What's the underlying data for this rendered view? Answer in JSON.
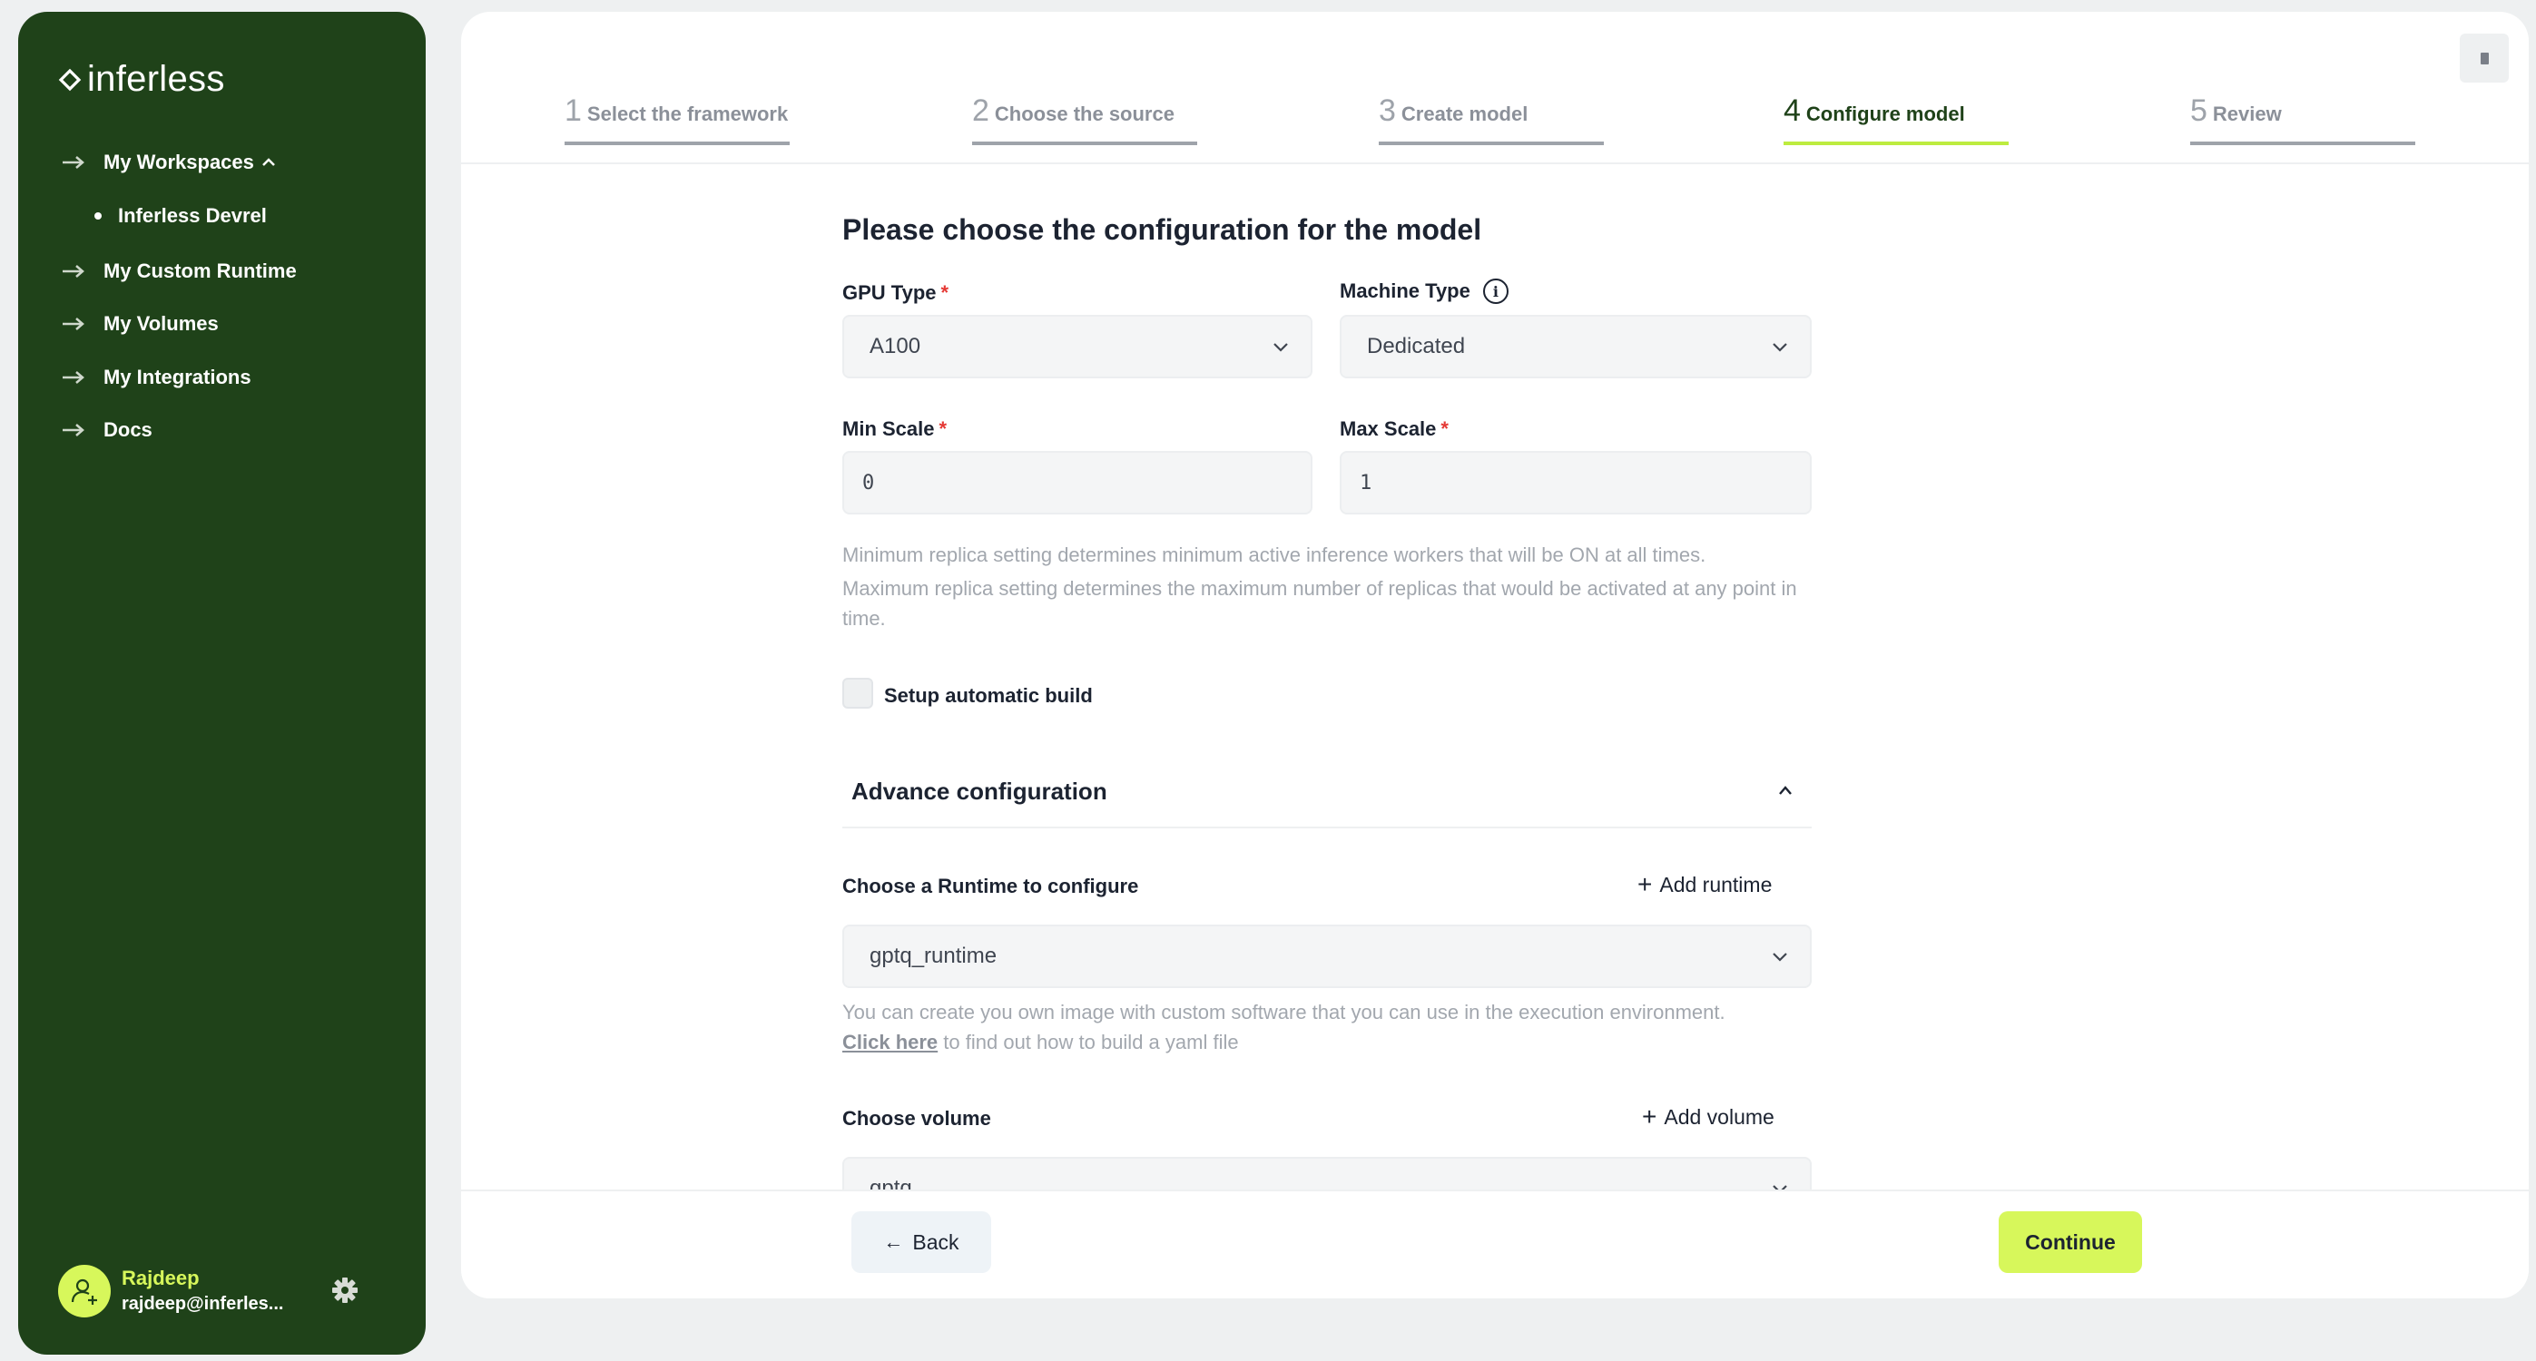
{
  "sidebar": {
    "logo": "inferless",
    "workspaces_label": "My Workspaces",
    "workspace_item": "Inferless Devrel",
    "items": [
      {
        "label": "My Custom Runtime"
      },
      {
        "label": "My Volumes"
      },
      {
        "label": "My Integrations"
      },
      {
        "label": "Docs"
      }
    ],
    "user": {
      "name": "Rajdeep",
      "email": "rajdeep@inferles..."
    }
  },
  "steps": [
    {
      "num": "1",
      "label": "Select the framework"
    },
    {
      "num": "2",
      "label": "Choose the source"
    },
    {
      "num": "3",
      "label": "Create model"
    },
    {
      "num": "4",
      "label": "Configure model"
    },
    {
      "num": "5",
      "label": "Review"
    }
  ],
  "active_step": 4,
  "form": {
    "title": "Please choose the configuration for the model",
    "gpu_type": {
      "label": "GPU Type",
      "required": "*",
      "value": "A100"
    },
    "machine_type": {
      "label": "Machine Type",
      "info": "i",
      "value": "Dedicated"
    },
    "min_scale": {
      "label": "Min Scale",
      "required": "*",
      "value": "0"
    },
    "max_scale": {
      "label": "Max Scale",
      "required": "*",
      "value": "1"
    },
    "scale_help_1": "Minimum replica setting determines minimum active inference workers that will be ON at all times.",
    "scale_help_2": "Maximum replica setting determines the maximum number of replicas that would be activated at any point in time.",
    "auto_build": {
      "label": "Setup automatic build",
      "checked": false
    },
    "advance": {
      "title": "Advance configuration",
      "runtime": {
        "label": "Choose a Runtime to configure",
        "add_label": "Add runtime",
        "value": "gptq_runtime",
        "help": "You can create you own image with custom software that you can use in the execution environment.",
        "help_link": "Click here",
        "help_tail": " to find out how to build a yaml file"
      },
      "volume": {
        "label": "Choose volume",
        "add_label": "Add volume",
        "value": "gptq"
      }
    }
  },
  "footer": {
    "back_label": "Back",
    "continue_label": "Continue"
  },
  "colors": {
    "sidebar": "#1f4219",
    "accent": "#d7f75b",
    "active_step": "#bdec3f"
  }
}
